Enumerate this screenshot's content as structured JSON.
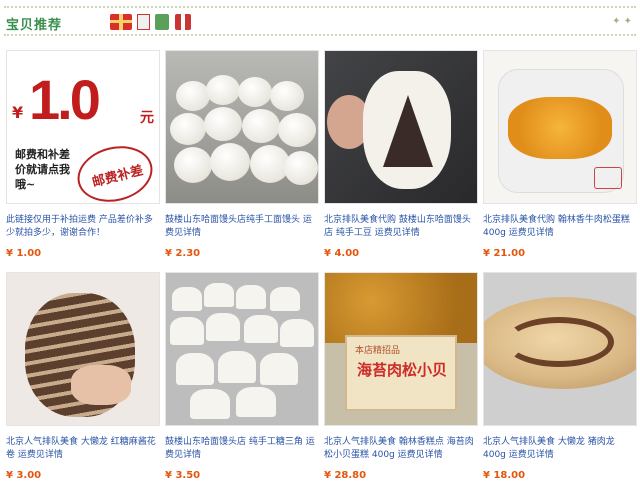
{
  "header": {
    "title": "宝贝推荐",
    "stars": "✦ ✦"
  },
  "promo_card": {
    "big_price": "1.0",
    "currency": "¥",
    "unit": "元",
    "body_text": "邮费和补差价就请点我哦~",
    "stamp_text": "邮费补差"
  },
  "products": [
    {
      "title": "此链接仅用于补拍运费 产品差价补多少就拍多少，谢谢合作！",
      "price": "¥ 1.00"
    },
    {
      "title": "鼓楼山东哈面馒头店纯手工面馒头 运费见详情",
      "price": "¥ 2.30"
    },
    {
      "title": "北京排队美食代购 鼓楼山东哈面馒头店 纯手工豆 运费见详情",
      "price": "¥ 4.00"
    },
    {
      "title": "北京排队美食代购 翰林香牛肉松蛋糕 400g 运费见详情",
      "price": "¥ 21.00"
    },
    {
      "title": "北京人气排队美食 大懒龙 红糖麻酱花卷 运费见详情",
      "price": "¥ 3.00"
    },
    {
      "title": "鼓楼山东哈面馒头店 纯手工糖三角 运费见详情",
      "price": "¥ 3.50"
    },
    {
      "title": "北京人气排队美食 翰林香糕点 海苔肉松小贝蛋糕 400g 运费见详情",
      "price": "¥ 28.80"
    },
    {
      "title": "北京人气排队美食 大懒龙 猪肉龙 400g 运费见详情",
      "price": "¥ 18.00"
    }
  ],
  "floss_sign": {
    "top": "本店精招品",
    "main": "海苔肉松小贝"
  }
}
